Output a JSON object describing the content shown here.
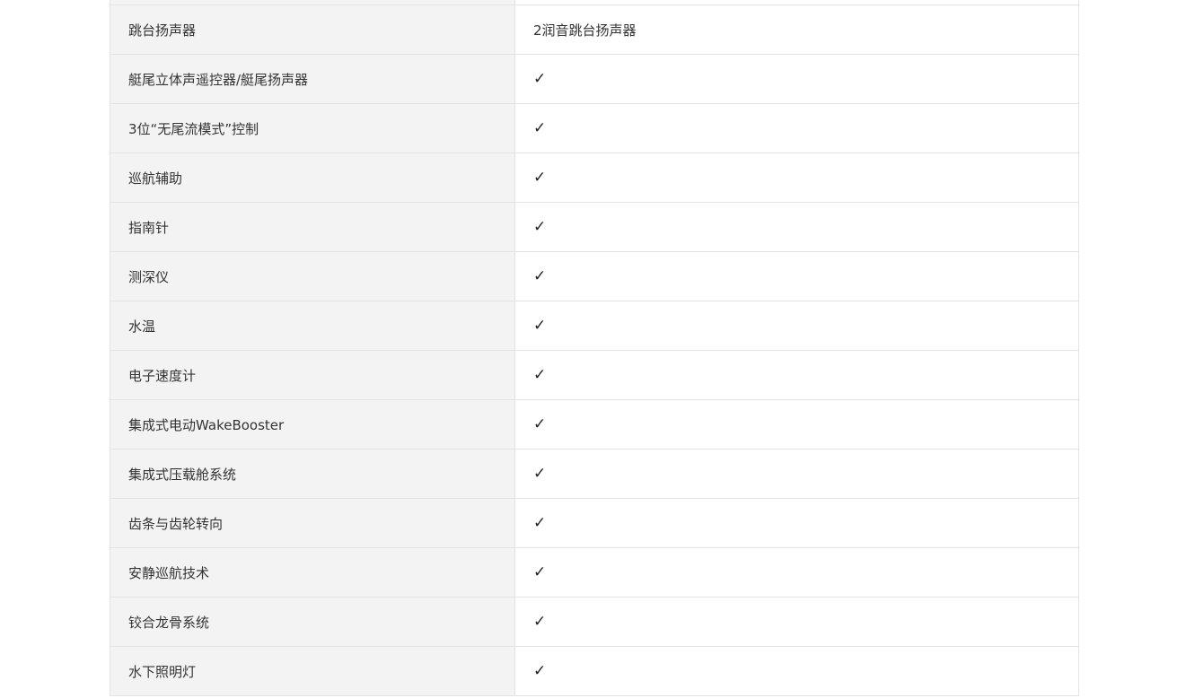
{
  "spec_table": {
    "rows": [
      {
        "label": "",
        "value": ""
      },
      {
        "label": "跳台扬声器",
        "value": "2润音跳台扬声器"
      },
      {
        "label": "艇尾立体声遥控器/艇尾扬声器",
        "value": "✓"
      },
      {
        "label": "3位“无尾流模式”控制",
        "value": "✓"
      },
      {
        "label": "巡航辅助",
        "value": "✓"
      },
      {
        "label": "指南针",
        "value": "✓"
      },
      {
        "label": "测深仪",
        "value": "✓"
      },
      {
        "label": "水温",
        "value": "✓"
      },
      {
        "label": "电子速度计",
        "value": "✓"
      },
      {
        "label": "集成式电动WakeBooster",
        "value": "✓"
      },
      {
        "label": "集成式压载舱系统",
        "value": "✓"
      },
      {
        "label": "齿条与齿轮转向",
        "value": "✓"
      },
      {
        "label": "安静巡航技术",
        "value": "✓"
      },
      {
        "label": "铰合龙骨系统",
        "value": "✓"
      },
      {
        "label": "水下照明灯",
        "value": "✓"
      }
    ]
  }
}
